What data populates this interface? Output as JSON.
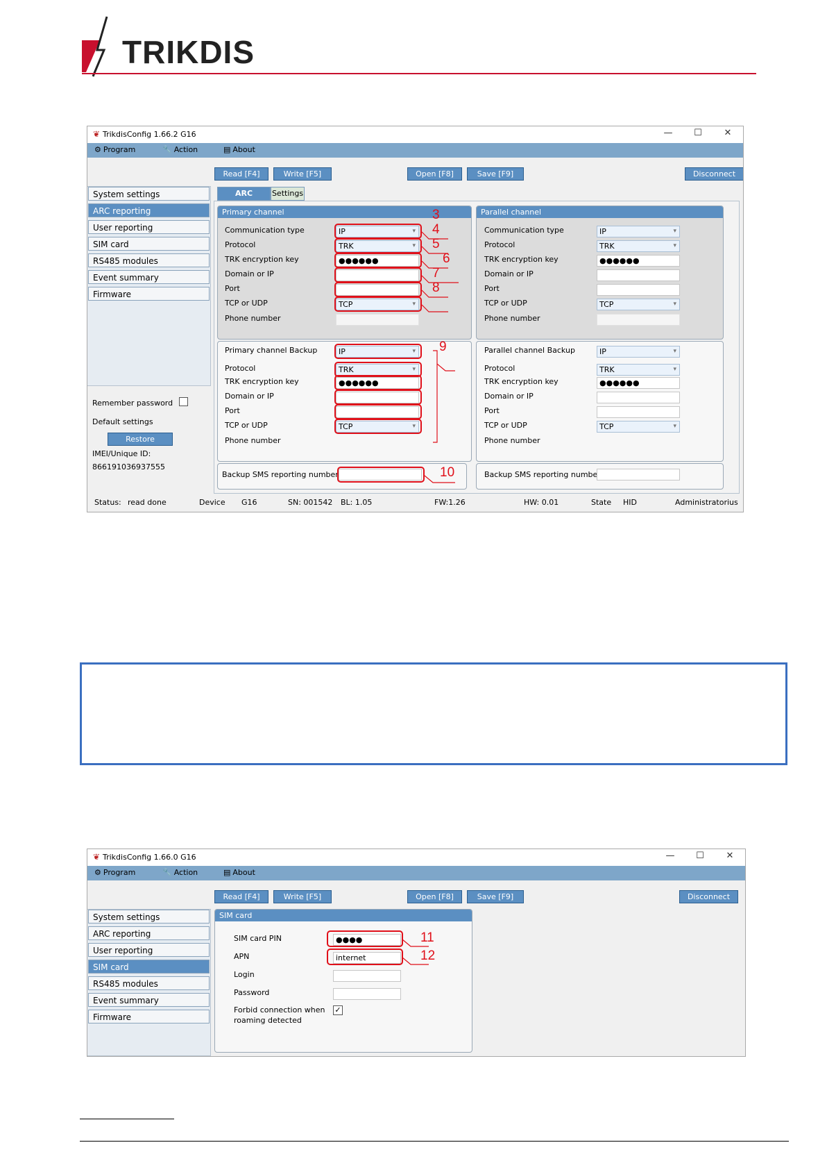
{
  "header": {
    "logo_text": "TRIKDIS",
    "brand_color": "#c8102e"
  },
  "window1": {
    "title": "TrikdisConfig 1.66.2   G16",
    "menu": [
      {
        "icon": "gear-icon",
        "label": "Program"
      },
      {
        "icon": "wrench-icon",
        "label": "Action"
      },
      {
        "icon": "book-icon",
        "label": "About"
      }
    ],
    "toolbar": {
      "read": "Read [F4]",
      "write": "Write [F5]",
      "open": "Open [F8]",
      "save": "Save [F9]",
      "disconnect": "Disconnect"
    },
    "sidebar": [
      "System settings",
      "ARC reporting",
      "User reporting",
      "SIM card",
      "RS485 modules",
      "Event summary",
      "Firmware"
    ],
    "sidebar_active": "ARC reporting",
    "remember_password": "Remember password",
    "default_settings": "Default settings",
    "restore": "Restore",
    "imei_label": "IMEI/Unique ID:",
    "imei_value": "866191036937555",
    "tabs": [
      "ARC settings",
      "Settings"
    ],
    "primary": {
      "title": "Primary channel",
      "labels": [
        "Communication type",
        "Protocol",
        "TRK encryption key",
        "Domain or IP",
        "Port",
        "TCP or UDP",
        "Phone number"
      ],
      "comm_type": "IP",
      "protocol": "TRK",
      "key": "●●●●●●",
      "tcp_udp": "TCP"
    },
    "parallel": {
      "title": "Parallel channel",
      "labels": [
        "Communication type",
        "Protocol",
        "TRK encryption key",
        "Domain or IP",
        "Port",
        "TCP or UDP",
        "Phone number"
      ],
      "comm_type": "IP",
      "protocol": "TRK",
      "key": "●●●●●●",
      "tcp_udp": "TCP"
    },
    "primary_backup": {
      "labels": [
        "Primary channel Backup",
        "Protocol",
        "TRK encryption key",
        "Domain or IP",
        "Port",
        "TCP or UDP",
        "Phone number"
      ],
      "comm_type": "IP",
      "protocol": "TRK",
      "key": "●●●●●●",
      "tcp_udp": "TCP"
    },
    "parallel_backup": {
      "labels": [
        "Parallel channel Backup",
        "Protocol",
        "TRK encryption key",
        "Domain or IP",
        "Port",
        "TCP or UDP",
        "Phone number"
      ],
      "comm_type": "IP",
      "protocol": "TRK",
      "key": "●●●●●●",
      "tcp_udp": "TCP"
    },
    "backup_sms": "Backup SMS reporting number",
    "callouts": [
      "3",
      "4",
      "5",
      "6",
      "7",
      "8",
      "9",
      "10"
    ],
    "status": {
      "status_label": "Status:",
      "status_value": "read done",
      "device_label": "Device",
      "device_value": "G16",
      "sn": "SN: 001542",
      "bl": "BL: 1.05",
      "fw": "FW:1.26",
      "hw": "HW:  0.01",
      "state_label": "State",
      "state_value": "HID",
      "user": "Administratorius"
    }
  },
  "window2": {
    "title": "TrikdisConfig 1.66.0   G16",
    "menu": [
      {
        "icon": "gear-icon",
        "label": "Program"
      },
      {
        "icon": "wrench-icon",
        "label": "Action"
      },
      {
        "icon": "book-icon",
        "label": "About"
      }
    ],
    "toolbar": {
      "read": "Read [F4]",
      "write": "Write [F5]",
      "open": "Open [F8]",
      "save": "Save [F9]",
      "disconnect": "Disconnect"
    },
    "sidebar": [
      "System settings",
      "ARC reporting",
      "User reporting",
      "SIM card",
      "RS485 modules",
      "Event summary",
      "Firmware"
    ],
    "sidebar_active": "SIM card",
    "panel_title": "SIM card",
    "labels": {
      "pin": "SIM card PIN",
      "apn": "APN",
      "login": "Login",
      "password": "Password",
      "roaming_1": "Forbid connection when",
      "roaming_2": "roaming detected"
    },
    "values": {
      "pin": "●●●●",
      "apn": "internet"
    },
    "roaming_checked": true,
    "callouts": [
      "11",
      "12"
    ]
  }
}
